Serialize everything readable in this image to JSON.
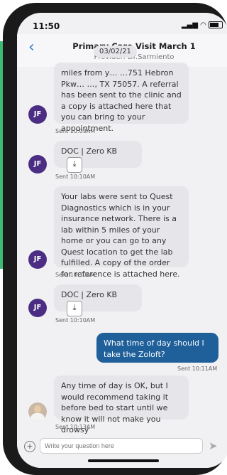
{
  "status": {
    "time": "11:50"
  },
  "header": {
    "title": "Primary Care Visit March 1",
    "subtitle": "Provider: Dr.Sarmiento",
    "date_pill": "03/02/21"
  },
  "messages": [
    {
      "avatar": "JF",
      "text": "miles from y… …751 Hebron Pkw… …, TX 75057. A referral has been sent to the clinic and a copy is attached here that you can bring to your appointment.",
      "sent": "Sent 10:09AM"
    },
    {
      "avatar": "JF",
      "text": "DOC | Zero KB",
      "sent": "Sent 10:10AM"
    },
    {
      "avatar": "JF",
      "text": "Your labs were sent to Quest Diagnostics which is in your insurance network. There is a lab within 5 miles of your home or you can go to any Quest location to get the lab fulfilled. A copy of the order for reference is attached here.",
      "sent": "Sent 10:10AM"
    },
    {
      "avatar": "JF",
      "text": "DOC | Zero KB",
      "sent": "Sent 10:10AM"
    },
    {
      "text": "What time of day should I take the Zoloft?",
      "sent": "Sent 10:11AM"
    },
    {
      "text": "Any time of day is OK, but I would recommend taking it before bed to start until we know it will not make you drowsy",
      "sent": "Sent 10:13AM"
    }
  ],
  "composer": {
    "placeholder": "Write your question here"
  }
}
